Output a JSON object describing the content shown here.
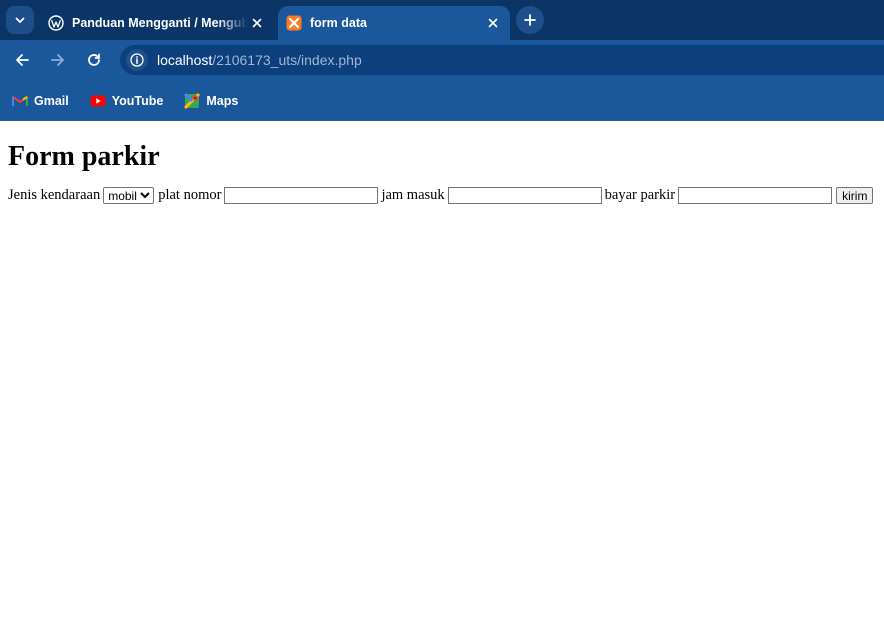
{
  "browser": {
    "tabs": [
      {
        "title": "Panduan Mengganti / Mengubah",
        "favicon": "wordpress-icon",
        "active": false
      },
      {
        "title": "form data",
        "favicon": "xampp-icon",
        "active": true
      }
    ],
    "address": {
      "host": "localhost",
      "path": "/2106173_uts/index.php"
    },
    "bookmarks": [
      {
        "label": "Gmail",
        "icon": "gmail-icon"
      },
      {
        "label": "YouTube",
        "icon": "youtube-icon"
      },
      {
        "label": "Maps",
        "icon": "maps-icon"
      }
    ],
    "colors": {
      "tabstrip": "#0b3566",
      "toolbar": "#1b579b",
      "omnibox": "#0e3f7d"
    }
  },
  "page": {
    "heading": "Form parkir",
    "form": {
      "jenis_label": "Jenis kendaraan",
      "jenis_selected": "mobil",
      "plat_label": "plat nomor",
      "plat_value": "",
      "jam_label": "jam masuk",
      "jam_value": "",
      "bayar_label": "bayar parkir",
      "bayar_value": "",
      "submit_label": "kirim"
    }
  }
}
